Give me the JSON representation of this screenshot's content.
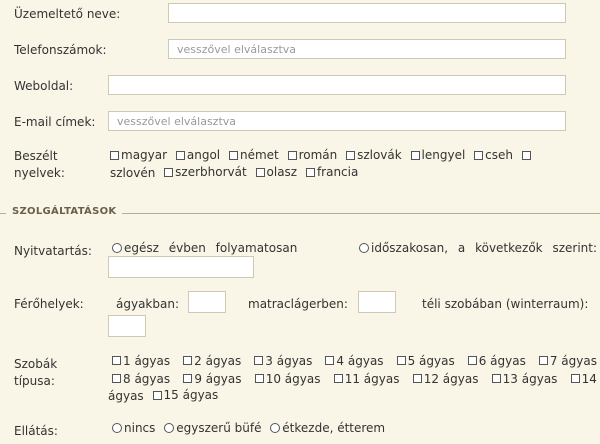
{
  "fields": {
    "operator_name": {
      "label": "Üzemeltető neve:",
      "value": ""
    },
    "phones": {
      "label": "Telefonszámok:",
      "placeholder": "vesszővel elválasztva"
    },
    "website": {
      "label": "Weboldal:",
      "value": ""
    },
    "emails": {
      "label": "E-mail címek:",
      "placeholder": "vesszővel elválasztva"
    }
  },
  "languages": {
    "label_line1": "Beszélt",
    "label_line2": "nyelvek:",
    "options": [
      "magyar",
      "angol",
      "német",
      "román",
      "szlovák",
      "lengyel",
      "cseh",
      "",
      "szlovén",
      "szerbhorvát",
      "olasz",
      "francia"
    ]
  },
  "section": {
    "title": "SZOLGÁLTATÁSOK"
  },
  "opening": {
    "label": "Nyitvatartás:",
    "option1": "egész évben folyamatosan",
    "option2": "időszakosan, a következők szerint:"
  },
  "places": {
    "label": "Férőhelyek:",
    "beds": "ágyakban:",
    "mattress": "matraclágerben:",
    "winter": "téli szobában (winterraum):"
  },
  "rooms": {
    "label_line1": "Szobák",
    "label_line2": "típusa:",
    "options": [
      "1 ágyas",
      "2 ágyas",
      "3 ágyas",
      "4 ágyas",
      "5 ágyas",
      "6 ágyas",
      "7 ágyas",
      "8 ágyas",
      "9 ágyas",
      "10 ágyas",
      "11 ágyas",
      "12 ágyas",
      "13 ágyas",
      "14",
      "ágyas",
      "15 ágyas"
    ]
  },
  "catering": {
    "label": "Ellátás:",
    "options": [
      "nincs",
      "egyszerű büfé",
      "étkezde, étterem"
    ]
  }
}
